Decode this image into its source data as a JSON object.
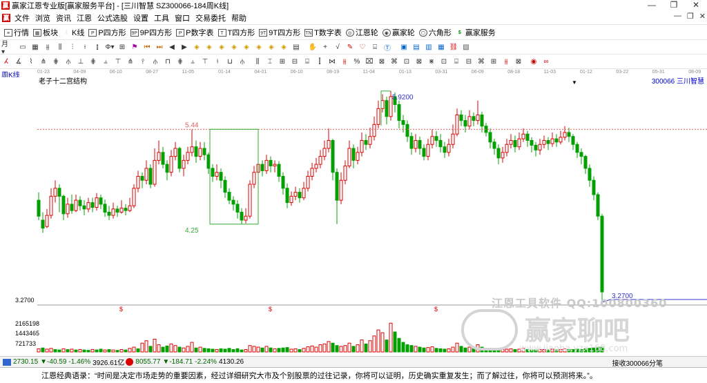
{
  "window": {
    "title": "赢家江恩专业版[赢家服务平台] - [三川智慧  SZ300066-184周K线]",
    "controls": [
      "—",
      "❐",
      "✕"
    ]
  },
  "menu": {
    "items": [
      "文件",
      "浏览",
      "资讯",
      "江恩",
      "公式选股",
      "设置",
      "工具",
      "窗口",
      "交易委托",
      "帮助"
    ],
    "mdi": [
      "—",
      "❐",
      "✕"
    ]
  },
  "toolbar1": {
    "items": [
      {
        "icon": "list-icon",
        "label": "行情"
      },
      {
        "icon": "block-icon",
        "label": "板块"
      },
      {
        "icon": "kline-icon",
        "label": "K线"
      },
      {
        "icon": "p-square-icon",
        "label": "P四方形"
      },
      {
        "icon": "9p-square-icon",
        "label": "9P四方形"
      },
      {
        "icon": "p-number-icon",
        "label": "P数字表"
      },
      {
        "icon": "t-square-icon",
        "label": "T四方形"
      },
      {
        "icon": "9t-square-icon",
        "label": "9T四方形"
      },
      {
        "icon": "t-number-icon",
        "label": "T数字表"
      },
      {
        "icon": "gann-wheel-icon",
        "label": "江恩轮"
      },
      {
        "icon": "winner-wheel-icon",
        "label": "赢家轮"
      },
      {
        "icon": "hexagon-icon",
        "label": "六角形"
      },
      {
        "icon": "dollar-icon",
        "label": "赢家服务"
      }
    ]
  },
  "chart_header": {
    "period": "周K线",
    "name": "老子十二宫结构",
    "code": "300066",
    "stock": "三川智慧"
  },
  "date_ticks": [
    "01-23",
    "04-09",
    "06-10",
    "08-27",
    "11-05",
    "01-14",
    "04-01",
    "06-10",
    "08-19",
    "11-04",
    "01-13",
    "03-31",
    "06-09",
    "08-18",
    "11-03",
    "01-12",
    "03-22",
    "05-31",
    "08-09"
  ],
  "chart_data": {
    "type": "candlestick",
    "title": "",
    "price_labels": {
      "high": "5.9200",
      "low": "3.2700",
      "mark_high": "5.44",
      "mark_low": "4.25"
    },
    "axis_labels": [
      "3.2700",
      "2165198",
      "1443465",
      "721733"
    ],
    "ref_line": 5.44,
    "ylim": [
      3.27,
      6.04
    ],
    "highlight_box": {
      "x_from": 42,
      "x_to": 53,
      "high": 5.44,
      "low": 4.25
    },
    "candles": [
      [
        4.55,
        4.35,
        4.65,
        4.3
      ],
      [
        4.3,
        4.2,
        4.4,
        4.14
      ],
      [
        4.22,
        4.36,
        4.44,
        4.2
      ],
      [
        4.36,
        4.6,
        4.7,
        4.32
      ],
      [
        4.6,
        4.7,
        4.8,
        4.52
      ],
      [
        4.7,
        4.6,
        4.75,
        4.4
      ],
      [
        4.6,
        4.38,
        4.62,
        4.3
      ],
      [
        4.38,
        4.5,
        4.58,
        4.33
      ],
      [
        4.5,
        4.42,
        4.62,
        4.38
      ],
      [
        4.42,
        4.55,
        4.62,
        4.4
      ],
      [
        4.55,
        4.48,
        4.6,
        4.42
      ],
      [
        4.48,
        4.44,
        4.55,
        4.36
      ],
      [
        4.44,
        4.52,
        4.58,
        4.4
      ],
      [
        4.52,
        4.46,
        4.58,
        4.4
      ],
      [
        4.46,
        4.58,
        4.64,
        4.42
      ],
      [
        4.58,
        4.5,
        4.62,
        4.44
      ],
      [
        4.5,
        4.4,
        4.56,
        4.34
      ],
      [
        4.4,
        4.36,
        4.48,
        4.3
      ],
      [
        4.36,
        4.44,
        4.52,
        4.32
      ],
      [
        4.44,
        4.4,
        4.48,
        4.34
      ],
      [
        4.4,
        4.45,
        4.55,
        4.38
      ],
      [
        4.45,
        4.42,
        4.5,
        4.36
      ],
      [
        4.42,
        4.48,
        4.58,
        4.4
      ],
      [
        4.48,
        4.7,
        4.75,
        4.45
      ],
      [
        4.7,
        4.85,
        4.92,
        4.65
      ],
      [
        4.85,
        4.8,
        4.9,
        4.7
      ],
      [
        4.8,
        4.95,
        5.05,
        4.75
      ],
      [
        4.95,
        4.75,
        5.0,
        4.7
      ],
      [
        4.75,
        5.05,
        5.2,
        4.72
      ],
      [
        5.05,
        5.15,
        5.3,
        5.0
      ],
      [
        5.15,
        5.0,
        5.22,
        4.95
      ],
      [
        5.0,
        4.9,
        5.05,
        4.8
      ],
      [
        4.9,
        5.1,
        5.18,
        4.85
      ],
      [
        5.1,
        5.2,
        5.28,
        5.05
      ],
      [
        5.2,
        4.95,
        5.22,
        4.9
      ],
      [
        4.95,
        5.05,
        5.12,
        4.85
      ],
      [
        5.05,
        5.15,
        5.22,
        5.0
      ],
      [
        5.15,
        5.22,
        5.44,
        5.1
      ],
      [
        5.22,
        5.1,
        5.3,
        5.02
      ],
      [
        5.1,
        5.2,
        5.28,
        5.05
      ],
      [
        5.2,
        5.12,
        5.28,
        5.05
      ],
      [
        5.12,
        4.95,
        5.15,
        4.88
      ],
      [
        4.95,
        4.85,
        5.0,
        4.78
      ],
      [
        4.85,
        4.9,
        5.0,
        4.8
      ],
      [
        4.9,
        4.8,
        4.95,
        4.7
      ],
      [
        4.8,
        4.65,
        4.85,
        4.58
      ],
      [
        4.65,
        4.55,
        4.7,
        4.5
      ],
      [
        4.55,
        4.5,
        4.6,
        4.42
      ],
      [
        4.5,
        4.4,
        4.55,
        4.32
      ],
      [
        4.4,
        4.3,
        4.45,
        4.25
      ],
      [
        4.3,
        4.35,
        4.45,
        4.26
      ],
      [
        4.35,
        4.75,
        4.8,
        4.32
      ],
      [
        4.75,
        4.9,
        4.98,
        4.7
      ],
      [
        4.9,
        5.0,
        5.08,
        4.85
      ],
      [
        5.0,
        4.92,
        5.05,
        4.85
      ],
      [
        4.92,
        5.05,
        5.12,
        4.88
      ],
      [
        5.05,
        4.98,
        5.1,
        4.9
      ],
      [
        4.98,
        5.0,
        5.05,
        4.9
      ],
      [
        5.0,
        4.85,
        5.04,
        4.78
      ],
      [
        4.85,
        4.7,
        4.9,
        4.62
      ],
      [
        4.7,
        4.52,
        4.76,
        4.45
      ],
      [
        4.52,
        4.6,
        4.66,
        4.48
      ],
      [
        4.6,
        4.65,
        4.72,
        4.55
      ],
      [
        4.65,
        4.58,
        4.7,
        4.52
      ],
      [
        4.58,
        4.7,
        4.78,
        4.55
      ],
      [
        4.7,
        4.85,
        4.92,
        4.66
      ],
      [
        4.85,
        4.95,
        5.02,
        4.8
      ],
      [
        4.95,
        5.0,
        5.08,
        4.9
      ],
      [
        5.0,
        5.1,
        5.18,
        4.95
      ],
      [
        5.1,
        5.2,
        5.3,
        5.05
      ],
      [
        5.2,
        5.3,
        5.45,
        5.15
      ],
      [
        5.3,
        4.9,
        5.32,
        4.8
      ],
      [
        4.9,
        4.55,
        4.95,
        4.25
      ],
      [
        4.55,
        4.8,
        4.9,
        4.5
      ],
      [
        4.8,
        4.98,
        5.05,
        4.75
      ],
      [
        4.98,
        5.2,
        5.3,
        4.95
      ],
      [
        5.2,
        5.05,
        5.25,
        4.95
      ],
      [
        5.05,
        5.15,
        5.22,
        5.0
      ],
      [
        5.15,
        5.3,
        5.4,
        5.1
      ],
      [
        5.3,
        5.25,
        5.38,
        5.18
      ],
      [
        5.25,
        5.35,
        5.46,
        5.2
      ],
      [
        5.35,
        5.5,
        5.6,
        5.3
      ],
      [
        5.5,
        5.7,
        5.8,
        5.45
      ],
      [
        5.7,
        5.8,
        5.88,
        5.65
      ],
      [
        5.8,
        5.6,
        5.85,
        5.5
      ],
      [
        5.6,
        5.85,
        5.92,
        5.55
      ],
      [
        5.85,
        5.75,
        5.9,
        5.65
      ],
      [
        5.75,
        5.55,
        5.8,
        5.45
      ],
      [
        5.55,
        5.5,
        5.62,
        5.4
      ],
      [
        5.5,
        5.35,
        5.55,
        5.28
      ],
      [
        5.35,
        5.2,
        5.4,
        5.12
      ],
      [
        5.2,
        5.3,
        5.38,
        5.15
      ],
      [
        5.3,
        5.2,
        5.35,
        5.12
      ],
      [
        5.2,
        5.1,
        5.25,
        5.05
      ],
      [
        5.1,
        5.25,
        5.32,
        5.05
      ],
      [
        5.25,
        5.35,
        5.44,
        5.2
      ],
      [
        5.35,
        5.3,
        5.42,
        5.22
      ],
      [
        5.3,
        5.22,
        5.38,
        5.15
      ],
      [
        5.22,
        5.15,
        5.28,
        5.08
      ],
      [
        5.15,
        5.25,
        5.32,
        5.1
      ],
      [
        5.25,
        5.38,
        5.5,
        5.2
      ],
      [
        5.38,
        5.62,
        5.7,
        5.35
      ],
      [
        5.62,
        5.55,
        5.68,
        5.48
      ],
      [
        5.55,
        5.48,
        5.62,
        5.4
      ],
      [
        5.48,
        5.6,
        5.68,
        5.44
      ],
      [
        5.6,
        5.55,
        5.65,
        5.48
      ],
      [
        5.55,
        5.62,
        5.8,
        5.5
      ],
      [
        5.62,
        5.48,
        5.66,
        5.4
      ],
      [
        5.48,
        5.4,
        5.52,
        5.35
      ],
      [
        5.4,
        5.28,
        5.45,
        5.2
      ],
      [
        5.28,
        5.2,
        5.32,
        5.12
      ],
      [
        5.2,
        5.08,
        5.25,
        5.0
      ],
      [
        5.08,
        5.15,
        5.22,
        5.02
      ],
      [
        5.15,
        5.25,
        5.32,
        5.1
      ],
      [
        5.25,
        5.3,
        5.38,
        5.2
      ],
      [
        5.3,
        5.22,
        5.36,
        5.15
      ],
      [
        5.22,
        5.32,
        5.4,
        5.18
      ],
      [
        5.32,
        5.38,
        5.45,
        5.28
      ],
      [
        5.38,
        5.3,
        5.42,
        5.22
      ],
      [
        5.3,
        5.24,
        5.34,
        5.15
      ],
      [
        5.24,
        5.18,
        5.28,
        5.1
      ],
      [
        5.18,
        5.25,
        5.32,
        5.12
      ],
      [
        5.25,
        5.3,
        5.36,
        5.2
      ],
      [
        5.3,
        5.26,
        5.34,
        5.18
      ],
      [
        5.26,
        5.32,
        5.4,
        5.22
      ],
      [
        5.32,
        5.28,
        5.38,
        5.22
      ],
      [
        5.28,
        5.34,
        5.42,
        5.25
      ],
      [
        5.34,
        5.4,
        5.48,
        5.3
      ],
      [
        5.4,
        5.35,
        5.46,
        5.28
      ],
      [
        5.35,
        5.25,
        5.38,
        5.18
      ],
      [
        5.25,
        5.15,
        5.28,
        5.08
      ],
      [
        5.15,
        5.1,
        5.2,
        5.0
      ],
      [
        5.1,
        4.95,
        5.12,
        4.88
      ],
      [
        4.95,
        4.8,
        5.0,
        4.72
      ],
      [
        4.8,
        4.62,
        4.85,
        4.55
      ],
      [
        4.62,
        4.35,
        4.65,
        4.3
      ],
      [
        4.35,
        3.4,
        4.38,
        3.27
      ]
    ],
    "volumes": [
      [
        0.08,
        1
      ],
      [
        0.1,
        0
      ],
      [
        0.07,
        1
      ],
      [
        0.09,
        1
      ],
      [
        0.06,
        0
      ],
      [
        0.05,
        0
      ],
      [
        0.08,
        1
      ],
      [
        0.06,
        0
      ],
      [
        0.07,
        1
      ],
      [
        0.05,
        0
      ],
      [
        0.06,
        1
      ],
      [
        0.05,
        0
      ],
      [
        0.04,
        0
      ],
      [
        0.06,
        1
      ],
      [
        0.05,
        0
      ],
      [
        0.07,
        0
      ],
      [
        0.05,
        1
      ],
      [
        0.06,
        0
      ],
      [
        0.05,
        1
      ],
      [
        0.04,
        0
      ],
      [
        0.06,
        1
      ],
      [
        0.05,
        0
      ],
      [
        0.09,
        1
      ],
      [
        0.12,
        1
      ],
      [
        0.08,
        0
      ],
      [
        0.22,
        1
      ],
      [
        0.28,
        1
      ],
      [
        0.14,
        0
      ],
      [
        0.32,
        1
      ],
      [
        0.18,
        1
      ],
      [
        0.12,
        0
      ],
      [
        0.15,
        0
      ],
      [
        0.2,
        1
      ],
      [
        0.16,
        1
      ],
      [
        0.12,
        0
      ],
      [
        0.1,
        1
      ],
      [
        0.14,
        1
      ],
      [
        0.24,
        1
      ],
      [
        0.1,
        0
      ],
      [
        0.12,
        1
      ],
      [
        0.09,
        0
      ],
      [
        0.08,
        0
      ],
      [
        0.07,
        0
      ],
      [
        0.06,
        1
      ],
      [
        0.08,
        0
      ],
      [
        0.07,
        0
      ],
      [
        0.09,
        0
      ],
      [
        0.06,
        0
      ],
      [
        0.08,
        0
      ],
      [
        0.05,
        0
      ],
      [
        0.06,
        1
      ],
      [
        0.16,
        1
      ],
      [
        0.14,
        1
      ],
      [
        0.12,
        1
      ],
      [
        0.1,
        0
      ],
      [
        0.14,
        1
      ],
      [
        0.1,
        0
      ],
      [
        0.08,
        1
      ],
      [
        0.09,
        0
      ],
      [
        0.1,
        0
      ],
      [
        0.11,
        0
      ],
      [
        0.07,
        1
      ],
      [
        0.08,
        1
      ],
      [
        0.06,
        0
      ],
      [
        0.09,
        1
      ],
      [
        0.13,
        1
      ],
      [
        0.15,
        1
      ],
      [
        0.12,
        1
      ],
      [
        0.18,
        1
      ],
      [
        0.2,
        1
      ],
      [
        0.26,
        1
      ],
      [
        0.22,
        0
      ],
      [
        0.16,
        0
      ],
      [
        0.14,
        1
      ],
      [
        0.16,
        1
      ],
      [
        0.22,
        1
      ],
      [
        0.14,
        0
      ],
      [
        0.18,
        1
      ],
      [
        0.3,
        1
      ],
      [
        0.2,
        0
      ],
      [
        0.28,
        1
      ],
      [
        0.4,
        1
      ],
      [
        0.55,
        1
      ],
      [
        0.48,
        1
      ],
      [
        0.3,
        0
      ],
      [
        0.72,
        1
      ],
      [
        0.5,
        0
      ],
      [
        0.34,
        0
      ],
      [
        0.24,
        0
      ],
      [
        0.18,
        0
      ],
      [
        0.16,
        0
      ],
      [
        0.14,
        1
      ],
      [
        0.12,
        0
      ],
      [
        0.1,
        0
      ],
      [
        0.11,
        1
      ],
      [
        0.13,
        1
      ],
      [
        0.09,
        0
      ],
      [
        0.08,
        0
      ],
      [
        0.07,
        0
      ],
      [
        0.08,
        1
      ],
      [
        0.12,
        1
      ],
      [
        0.22,
        1
      ],
      [
        0.14,
        0
      ],
      [
        0.1,
        0
      ],
      [
        0.12,
        1
      ],
      [
        0.09,
        0
      ],
      [
        0.18,
        1
      ],
      [
        0.12,
        0
      ],
      [
        0.08,
        0
      ],
      [
        0.07,
        0
      ],
      [
        0.06,
        0
      ],
      [
        0.07,
        0
      ],
      [
        0.06,
        1
      ],
      [
        0.07,
        1
      ],
      [
        0.08,
        1
      ],
      [
        0.06,
        0
      ],
      [
        0.07,
        1
      ],
      [
        0.09,
        1
      ],
      [
        0.06,
        0
      ],
      [
        0.05,
        0
      ],
      [
        0.05,
        0
      ],
      [
        0.06,
        1
      ],
      [
        0.06,
        1
      ],
      [
        0.05,
        0
      ],
      [
        0.07,
        1
      ],
      [
        0.05,
        0
      ],
      [
        0.06,
        1
      ],
      [
        0.08,
        1
      ],
      [
        0.06,
        0
      ],
      [
        0.06,
        0
      ],
      [
        0.07,
        0
      ],
      [
        0.06,
        0
      ],
      [
        0.08,
        0
      ],
      [
        0.09,
        0
      ],
      [
        0.1,
        0
      ],
      [
        0.12,
        0
      ],
      [
        0.12,
        0
      ]
    ],
    "dividend_marks": [
      20,
      56,
      96
    ]
  },
  "watermark": {
    "line1": "江恩工具软件  QQ:100800360",
    "logo": "赢家聊吧",
    "url": "www.jiaoba.yzx168.com"
  },
  "status": {
    "sh_value": "2730.15",
    "sh_change": "▼-40.59",
    "sh_pct": "-1.46%",
    "sh_amt": "3926.61亿",
    "sz_value": "8055.77",
    "sz_change": "▼-184.71",
    "sz_pct": "-2.24%",
    "sz_amt": "4130.26",
    "receiving": "接收300066分笔"
  },
  "quote": {
    "text": "江恩经典语录：“时间是决定市场走势的重要因素，经过详细研究大市及个别股票的过往记录，你将可以证明，历史确实重复发生；而了解过往，你将可以预测将来。”。"
  }
}
